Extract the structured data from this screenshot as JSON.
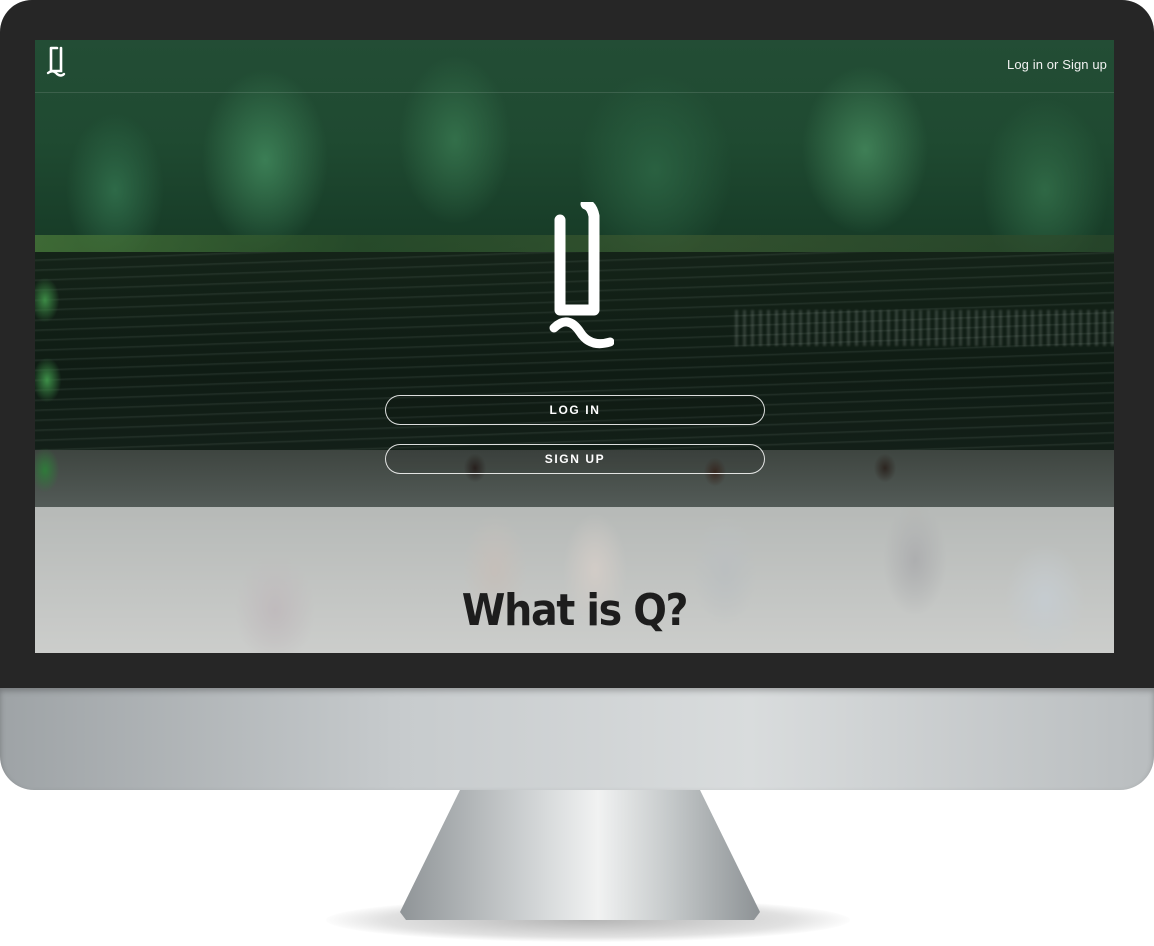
{
  "brand": {
    "logo_icon": "q-logo-icon",
    "logo_color": "#ffffff"
  },
  "header": {
    "auth_link_label": "Log in or Sign up"
  },
  "hero": {
    "logo_icon": "q-logo-icon",
    "login_button_label": "LOG IN",
    "signup_button_label": "SIGN UP"
  },
  "section": {
    "heading": "What is Q?"
  },
  "colors": {
    "bezel": "#262626",
    "button_border": "#ffffff",
    "heading_text": "#1d1d1d"
  }
}
